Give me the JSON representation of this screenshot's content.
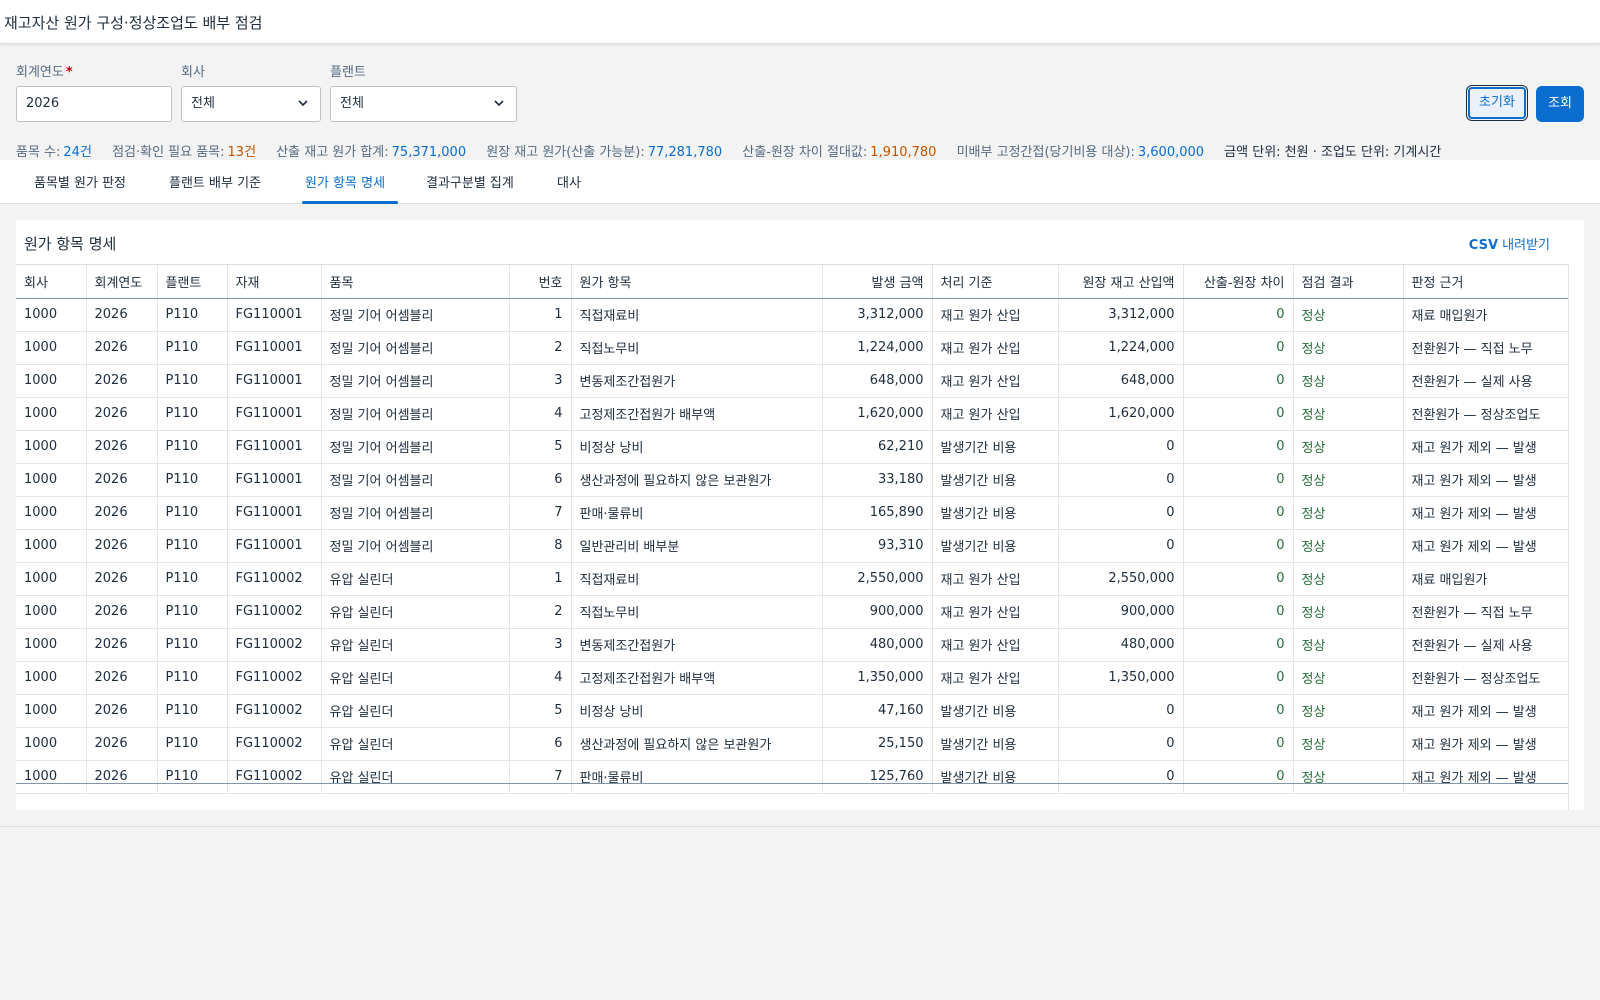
{
  "page": {
    "title": "재고자산 원가 구성·정상조업도 배부 점검"
  },
  "filters": {
    "fiscal_year": {
      "label": "회계연도",
      "required_mark": "*",
      "value": "2026"
    },
    "company": {
      "label": "회사",
      "value": "전체"
    },
    "plant": {
      "label": "플랜트",
      "value": "전체"
    }
  },
  "actions": {
    "reset_label": "초기화",
    "search_label": "조회"
  },
  "summary": {
    "item_count_label": "품목 수:",
    "item_count": "24건",
    "check_needed_label": "점검·확인 필요 품목:",
    "check_needed": "13건",
    "calc_total_label": "산출 재고 원가 합계:",
    "calc_total": "75,371,000",
    "ledger_total_label": "원장 재고 원가(산출 가능분):",
    "ledger_total": "77,281,780",
    "diff_abs_label": "산출-원장 차이 절대값:",
    "diff_abs": "1,910,780",
    "unallocated_label": "미배부 고정간접(당기비용 대상):",
    "unallocated": "3,600,000",
    "unit_text": "금액 단위: 천원 · 조업도 단위: 기계시간"
  },
  "tabs": [
    {
      "label": "품목별 원가 판정",
      "active": false
    },
    {
      "label": "플랜트 배부 기준",
      "active": false
    },
    {
      "label": "원가 항목 명세",
      "active": true
    },
    {
      "label": "결과구분별 집계",
      "active": false
    },
    {
      "label": "대사",
      "active": false
    }
  ],
  "panel": {
    "title": "원가 항목 명세",
    "csv_bold": "CSV",
    "csv_rest": " 내려받기"
  },
  "table": {
    "columns": [
      "회사",
      "회계연도",
      "플랜트",
      "자재",
      "품목",
      "번호",
      "원가 항목",
      "발생 금액",
      "처리 기준",
      "원장 재고 산입액",
      "산출-원장 차이",
      "점검 결과",
      "판정 근거"
    ],
    "rows": [
      [
        "1000",
        "2026",
        "P110",
        "FG110001",
        "정밀 기어 어셈블리",
        "1",
        "직접재료비",
        "3,312,000",
        "재고 원가 산입",
        "3,312,000",
        "0",
        "정상",
        "재료 매입원가"
      ],
      [
        "1000",
        "2026",
        "P110",
        "FG110001",
        "정밀 기어 어셈블리",
        "2",
        "직접노무비",
        "1,224,000",
        "재고 원가 산입",
        "1,224,000",
        "0",
        "정상",
        "전환원가 — 직접 노무"
      ],
      [
        "1000",
        "2026",
        "P110",
        "FG110001",
        "정밀 기어 어셈블리",
        "3",
        "변동제조간접원가",
        "648,000",
        "재고 원가 산입",
        "648,000",
        "0",
        "정상",
        "전환원가 — 실제 사용"
      ],
      [
        "1000",
        "2026",
        "P110",
        "FG110001",
        "정밀 기어 어셈블리",
        "4",
        "고정제조간접원가 배부액",
        "1,620,000",
        "재고 원가 산입",
        "1,620,000",
        "0",
        "정상",
        "전환원가 — 정상조업도"
      ],
      [
        "1000",
        "2026",
        "P110",
        "FG110001",
        "정밀 기어 어셈블리",
        "5",
        "비정상 낭비",
        "62,210",
        "발생기간 비용",
        "0",
        "0",
        "정상",
        "재고 원가 제외 — 발생"
      ],
      [
        "1000",
        "2026",
        "P110",
        "FG110001",
        "정밀 기어 어셈블리",
        "6",
        "생산과정에 필요하지 않은 보관원가",
        "33,180",
        "발생기간 비용",
        "0",
        "0",
        "정상",
        "재고 원가 제외 — 발생"
      ],
      [
        "1000",
        "2026",
        "P110",
        "FG110001",
        "정밀 기어 어셈블리",
        "7",
        "판매·물류비",
        "165,890",
        "발생기간 비용",
        "0",
        "0",
        "정상",
        "재고 원가 제외 — 발생"
      ],
      [
        "1000",
        "2026",
        "P110",
        "FG110001",
        "정밀 기어 어셈블리",
        "8",
        "일반관리비 배부분",
        "93,310",
        "발생기간 비용",
        "0",
        "0",
        "정상",
        "재고 원가 제외 — 발생"
      ],
      [
        "1000",
        "2026",
        "P110",
        "FG110002",
        "유압 실린더",
        "1",
        "직접재료비",
        "2,550,000",
        "재고 원가 산입",
        "2,550,000",
        "0",
        "정상",
        "재료 매입원가"
      ],
      [
        "1000",
        "2026",
        "P110",
        "FG110002",
        "유압 실린더",
        "2",
        "직접노무비",
        "900,000",
        "재고 원가 산입",
        "900,000",
        "0",
        "정상",
        "전환원가 — 직접 노무"
      ],
      [
        "1000",
        "2026",
        "P110",
        "FG110002",
        "유압 실린더",
        "3",
        "변동제조간접원가",
        "480,000",
        "재고 원가 산입",
        "480,000",
        "0",
        "정상",
        "전환원가 — 실제 사용"
      ],
      [
        "1000",
        "2026",
        "P110",
        "FG110002",
        "유압 실린더",
        "4",
        "고정제조간접원가 배부액",
        "1,350,000",
        "재고 원가 산입",
        "1,350,000",
        "0",
        "정상",
        "전환원가 — 정상조업도"
      ],
      [
        "1000",
        "2026",
        "P110",
        "FG110002",
        "유압 실린더",
        "5",
        "비정상 낭비",
        "47,160",
        "발생기간 비용",
        "0",
        "0",
        "정상",
        "재고 원가 제외 — 발생"
      ],
      [
        "1000",
        "2026",
        "P110",
        "FG110002",
        "유압 실린더",
        "6",
        "생산과정에 필요하지 않은 보관원가",
        "25,150",
        "발생기간 비용",
        "0",
        "0",
        "정상",
        "재고 원가 제외 — 발생"
      ],
      [
        "1000",
        "2026",
        "P110",
        "FG110002",
        "유압 실린더",
        "7",
        "판매·물류비",
        "125,760",
        "발생기간 비용",
        "0",
        "0",
        "정상",
        "재고 원가 제외 — 발생"
      ]
    ]
  },
  "colors": {
    "accent": "#0a6ed1",
    "warning": "#c35500",
    "positive": "#256f3a"
  }
}
